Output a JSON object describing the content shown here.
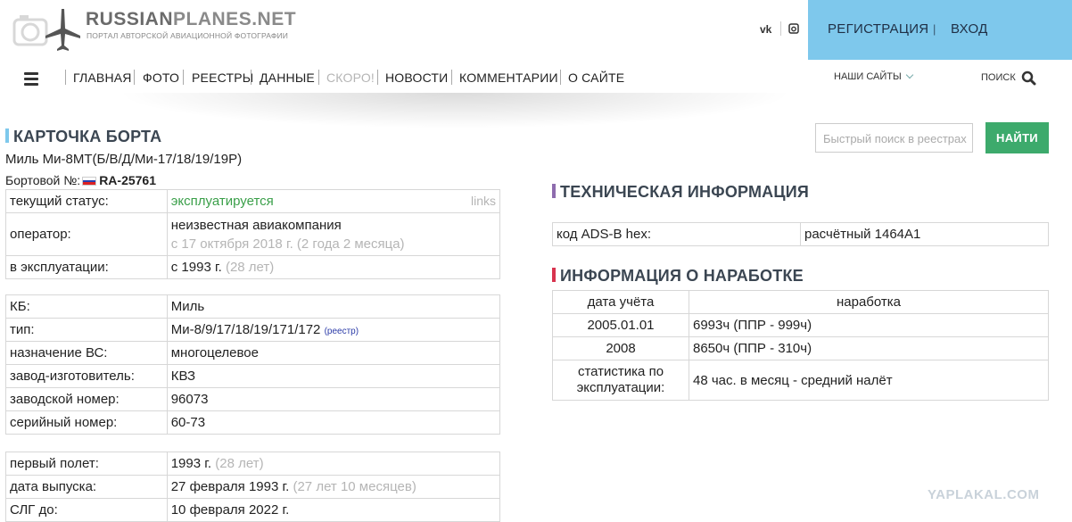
{
  "header": {
    "logo_title_a": "RUSSIAN",
    "logo_title_b": "PLANES.NET",
    "logo_sub": "ПОРТАЛ АВТОРСКОЙ АВИАЦИОННОЙ ФОТОГРАФИИ",
    "vk": "vk",
    "register": "РЕГИСТРАЦИЯ",
    "login": "ВХОД",
    "sep": "|"
  },
  "nav": {
    "items": [
      "ГЛАВНАЯ",
      "ФОТО",
      "РЕЕСТРЫ",
      "ДАННЫЕ",
      "СКОРО!",
      "НОВОСТИ",
      "КОММЕНТАРИИ",
      "О САЙТЕ"
    ],
    "our_sites": "НАШИ САЙТЫ",
    "search": "ПОИСК"
  },
  "card": {
    "title": "КАРТОЧКА БОРТА",
    "model": "Миль Ми-8МТ(Б/В/Д/Ми-17/18/19/19Р)",
    "reg_label": "Бортовой №:",
    "reg": "RA-25761",
    "accent": "#7ec8ec"
  },
  "search": {
    "placeholder": "Быстрый поиск в реестрах",
    "button": "НАЙТИ"
  },
  "status": {
    "k_status": "текущий статус:",
    "v_status": "эксплуатируется",
    "links": "links",
    "k_operator": "оператор:",
    "v_operator": "неизвестная авиакомпания",
    "v_operator_since": "с 17 октября 2018 г. (2 года 2 месяца)",
    "k_service": "в эксплуатации:",
    "v_service": "с 1993 г.",
    "v_service_age": "(28 лет)"
  },
  "specs": [
    {
      "k": "КБ:",
      "v": "Миль"
    },
    {
      "k": "тип:",
      "v": "Ми-8/9/17/18/19/171/172",
      "extra": "(реестр)"
    },
    {
      "k": "назначение ВС:",
      "v": "многоцелевое"
    },
    {
      "k": "завод-изготовитель:",
      "v": "КВЗ"
    },
    {
      "k": "заводской номер:",
      "v": "96073"
    },
    {
      "k": "серийный номер:",
      "v": "60-73"
    }
  ],
  "dates": {
    "k_first": "первый полет:",
    "v_first": "1993 г.",
    "v_first_age": "(28 лет)",
    "k_release": "дата выпуска:",
    "v_release": "27 февраля 1993 г.",
    "v_release_age": "(27 лет 10 месяцев)",
    "k_slg": "СЛГ до:",
    "v_slg": "10 февраля 2022 г."
  },
  "tech": {
    "title": "ТЕХНИЧЕСКАЯ ИНФОРМАЦИЯ",
    "k_adsb": "код ADS-B hex:",
    "v_adsb": "расчётный 1464A1",
    "accent": "#8e6cae"
  },
  "hours": {
    "title": "ИНФОРМАЦИЯ О НАРАБОТКЕ",
    "h_date": "дата учёта",
    "h_value": "наработка",
    "rows": [
      {
        "date": "2005.01.01",
        "value": "6993ч (ППР - 999ч)"
      },
      {
        "date": "2008",
        "value": "8650ч (ППР - 310ч)"
      }
    ],
    "stat_k": "статистика по эксплуатации:",
    "stat_v": "48 час. в месяц - средний налёт",
    "accent": "#d8344f"
  },
  "watermark": "YAPLAKAL.COM"
}
